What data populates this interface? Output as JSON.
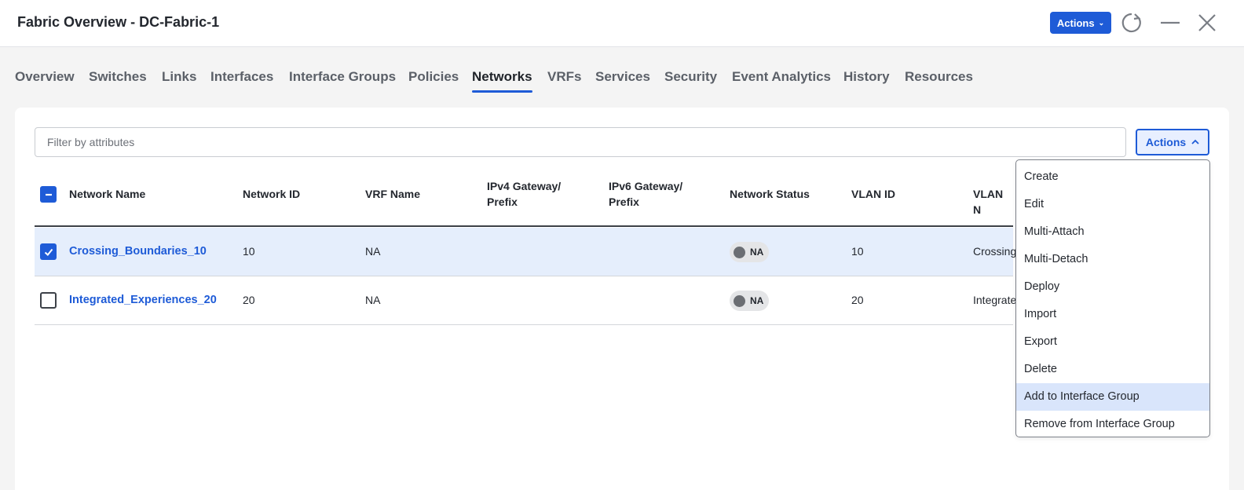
{
  "window": {
    "title": "Fabric Overview - DC-Fabric-1",
    "actions_label": "Actions"
  },
  "tabs": [
    {
      "label": "Overview"
    },
    {
      "label": "Switches"
    },
    {
      "label": "Links"
    },
    {
      "label": "Interfaces"
    },
    {
      "label": "Interface Groups"
    },
    {
      "label": "Policies"
    },
    {
      "label": "Networks",
      "active": true
    },
    {
      "label": "VRFs"
    },
    {
      "label": "Services"
    },
    {
      "label": "Security"
    },
    {
      "label": "Event Analytics"
    },
    {
      "label": "History"
    },
    {
      "label": "Resources"
    }
  ],
  "filter": {
    "placeholder": "Filter by attributes",
    "value": ""
  },
  "table_actions": {
    "label": "Actions"
  },
  "table": {
    "columns": {
      "network_name": "Network Name",
      "network_id": "Network ID",
      "vrf_name": "VRF Name",
      "ipv4_line1": "IPv4 Gateway/",
      "ipv4_line2": "Prefix",
      "ipv6_line1": "IPv6 Gateway/",
      "ipv6_line2": "Prefix",
      "network_status": "Network Status",
      "vlan_id": "VLAN ID",
      "vlan_name": "VLAN N"
    },
    "rows": [
      {
        "selected": true,
        "network_name": "Crossing_Boundaries_10",
        "network_id": "10",
        "vrf_name": "NA",
        "ipv4": "",
        "ipv6": "",
        "status": "NA",
        "vlan_id": "10",
        "vlan_name": "Crossing"
      },
      {
        "selected": false,
        "network_name": "Integrated_Experiences_20",
        "network_id": "20",
        "vrf_name": "NA",
        "ipv4": "",
        "ipv6": "",
        "status": "NA",
        "vlan_id": "20",
        "vlan_name": "Integrate"
      }
    ]
  },
  "actions_menu": [
    {
      "label": "Create"
    },
    {
      "label": "Edit"
    },
    {
      "label": "Multi-Attach"
    },
    {
      "label": "Multi-Detach"
    },
    {
      "label": "Deploy"
    },
    {
      "label": "Import"
    },
    {
      "label": "Export"
    },
    {
      "label": "Delete"
    },
    {
      "label": "Add to Interface Group",
      "highlighted": true
    },
    {
      "label": "Remove from Interface Group"
    }
  ],
  "colors": {
    "accent": "#1e5bd7",
    "selected_row": "#e5eefc",
    "menu_highlight": "#d9e5fb"
  }
}
